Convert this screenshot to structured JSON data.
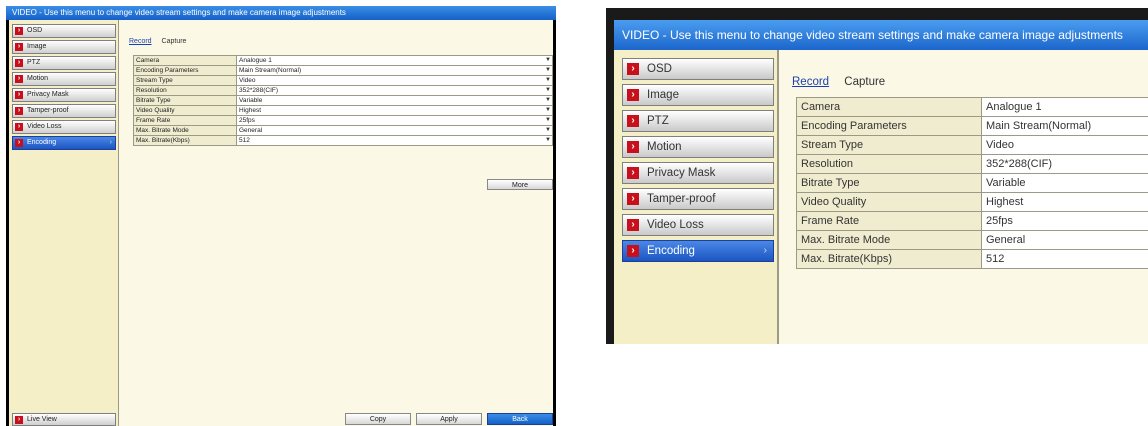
{
  "title": "VIDEO - Use this menu to change video stream settings and make camera image adjustments",
  "sidebar": {
    "items": [
      {
        "label": "OSD"
      },
      {
        "label": "Image"
      },
      {
        "label": "PTZ"
      },
      {
        "label": "Motion"
      },
      {
        "label": "Privacy Mask"
      },
      {
        "label": "Tamper-proof"
      },
      {
        "label": "Video Loss"
      },
      {
        "label": "Encoding",
        "active": true
      }
    ],
    "live_view": "Live View"
  },
  "tabs": [
    {
      "label": "Record",
      "selected": true
    },
    {
      "label": "Capture"
    }
  ],
  "settings": [
    {
      "label": "Camera",
      "value": "Analogue 1"
    },
    {
      "label": "Encoding Parameters",
      "value": "Main Stream(Normal)"
    },
    {
      "label": "Stream Type",
      "value": "Video"
    },
    {
      "label": "Resolution",
      "value": "352*288(CIF)"
    },
    {
      "label": "Bitrate Type",
      "value": "Variable"
    },
    {
      "label": "Video Quality",
      "value": "Highest"
    },
    {
      "label": "Frame Rate",
      "value": "25fps"
    },
    {
      "label": "Max. Bitrate Mode",
      "value": "General"
    },
    {
      "label": "Max. Bitrate(Kbps)",
      "value": "512"
    }
  ],
  "buttons": {
    "more": "More",
    "copy": "Copy",
    "apply": "Apply",
    "back": "Back"
  },
  "icons": {
    "nav_chevron": "chevron-right-icon",
    "dropdown": "chevron-down-icon"
  },
  "colors": {
    "titlebar": "#1c66cc",
    "panel_bg": "#fbf9e5",
    "sidebar_bg": "#f4efc6",
    "chevron": "#c8101c",
    "active_nav": "#1c55c2"
  }
}
